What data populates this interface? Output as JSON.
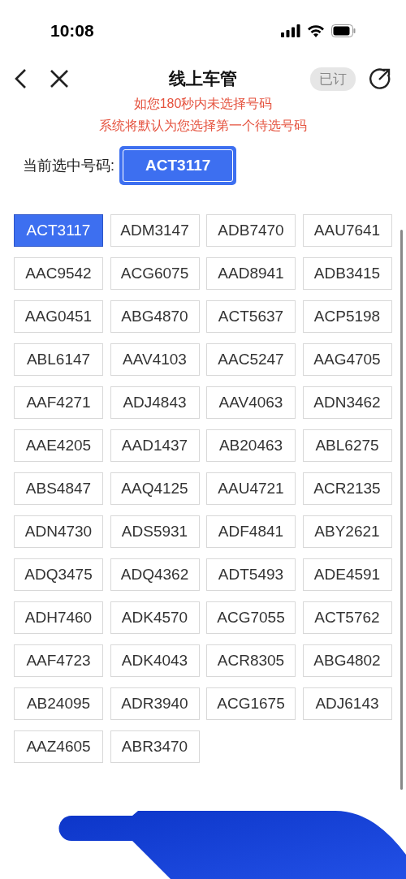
{
  "status_bar": {
    "time": "10:08"
  },
  "header": {
    "title": "线上车管",
    "badge": "已订"
  },
  "notice": [
    "如您180秒内未选择号码",
    "系统将默认为您选择第一个待选号码"
  ],
  "current": {
    "label": "当前选中号码:",
    "value": "ACT3117"
  },
  "plates": [
    {
      "number": "ACT3117",
      "selected": true
    },
    {
      "number": "ADM3147",
      "selected": false
    },
    {
      "number": "ADB7470",
      "selected": false
    },
    {
      "number": "AAU7641",
      "selected": false
    },
    {
      "number": "AAC9542",
      "selected": false
    },
    {
      "number": "ACG6075",
      "selected": false
    },
    {
      "number": "AAD8941",
      "selected": false
    },
    {
      "number": "ADB3415",
      "selected": false
    },
    {
      "number": "AAG0451",
      "selected": false
    },
    {
      "number": "ABG4870",
      "selected": false
    },
    {
      "number": "ACT5637",
      "selected": false
    },
    {
      "number": "ACP5198",
      "selected": false
    },
    {
      "number": "ABL6147",
      "selected": false
    },
    {
      "number": "AAV4103",
      "selected": false
    },
    {
      "number": "AAC5247",
      "selected": false
    },
    {
      "number": "AAG4705",
      "selected": false
    },
    {
      "number": "AAF4271",
      "selected": false
    },
    {
      "number": "ADJ4843",
      "selected": false
    },
    {
      "number": "AAV4063",
      "selected": false
    },
    {
      "number": "ADN3462",
      "selected": false
    },
    {
      "number": "AAE4205",
      "selected": false
    },
    {
      "number": "AAD1437",
      "selected": false
    },
    {
      "number": "AB20463",
      "selected": false
    },
    {
      "number": "ABL6275",
      "selected": false
    },
    {
      "number": "ABS4847",
      "selected": false
    },
    {
      "number": "AAQ4125",
      "selected": false
    },
    {
      "number": "AAU4721",
      "selected": false
    },
    {
      "number": "ACR2135",
      "selected": false
    },
    {
      "number": "ADN4730",
      "selected": false
    },
    {
      "number": "ADS5931",
      "selected": false
    },
    {
      "number": "ADF4841",
      "selected": false
    },
    {
      "number": "ABY2621",
      "selected": false
    },
    {
      "number": "ADQ3475",
      "selected": false
    },
    {
      "number": "ADQ4362",
      "selected": false
    },
    {
      "number": "ADT5493",
      "selected": false
    },
    {
      "number": "ADE4591",
      "selected": false
    },
    {
      "number": "ADH7460",
      "selected": false
    },
    {
      "number": "ADK4570",
      "selected": false
    },
    {
      "number": "ACG7055",
      "selected": false
    },
    {
      "number": "ACT5762",
      "selected": false
    },
    {
      "number": "AAF4723",
      "selected": false
    },
    {
      "number": "ADK4043",
      "selected": false
    },
    {
      "number": "ACR8305",
      "selected": false
    },
    {
      "number": "ABG4802",
      "selected": false
    },
    {
      "number": "AB24095",
      "selected": false
    },
    {
      "number": "ADR3940",
      "selected": false
    },
    {
      "number": "ACG1675",
      "selected": false
    },
    {
      "number": "ADJ6143",
      "selected": false
    },
    {
      "number": "AAZ4605",
      "selected": false
    },
    {
      "number": "ABR3470",
      "selected": false
    }
  ]
}
